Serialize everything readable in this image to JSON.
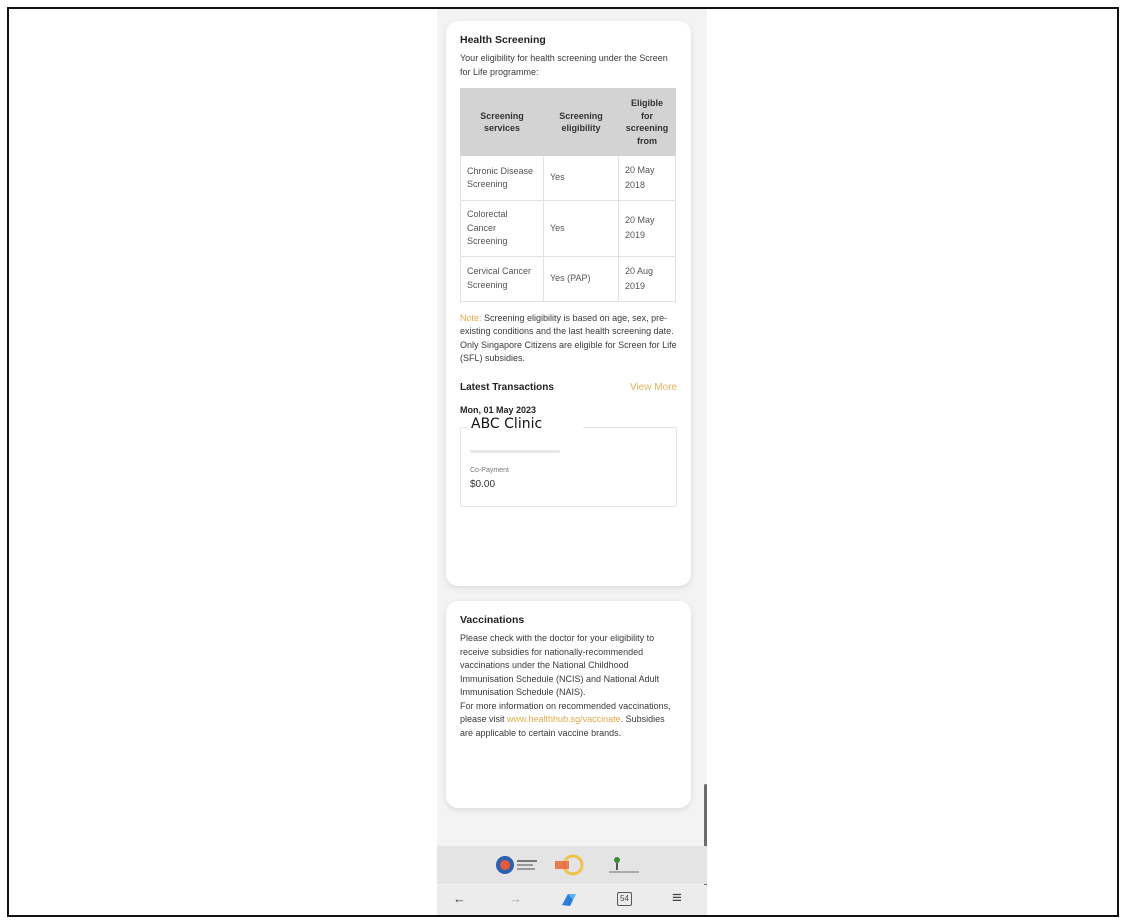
{
  "health": {
    "title": "Health Screening",
    "intro": "Your eligibility for health screening under the Screen for Life programme:",
    "table": {
      "headers": [
        "Screening services",
        "Screening eligibility",
        "Eligible for screening from"
      ],
      "rows": [
        {
          "service": "Chronic Disease Screening",
          "eligibility": "Yes",
          "from": "20 May 2018"
        },
        {
          "service": "Colorectal Cancer Screening",
          "eligibility": "Yes",
          "from": "20 May 2019"
        },
        {
          "service": "Cervical Cancer Screening",
          "eligibility": "Yes (PAP)",
          "from": "20 Aug 2019"
        }
      ]
    },
    "note_label": "Note:",
    "note_text": " Screening eligibility is based on age, sex, pre-existing conditions and the last health screening date. Only Singapore Citizens are eligible for Screen for Life (SFL) subsidies."
  },
  "transactions": {
    "title": "Latest Transactions",
    "view_more": "View More",
    "date": "Mon, 01 May 2023",
    "clinic": "ABC Clinic",
    "copay_label": "Co-Payment",
    "copay_value": "$0.00"
  },
  "vaccinations": {
    "title": "Vaccinations",
    "text1": "Please check with the doctor for your eligibility to receive subsidies for nationally-recommended vaccinations under the National Childhood Immunisation Schedule (NCIS) and National Adult Immunisation Schedule (NAIS).",
    "text2": "For more information on recommended vaccinations, please visit ",
    "link": "www.healthhub.sg/vaccinate",
    "text3": ". Subsidies are applicable to certain vaccine brands."
  },
  "navbar": {
    "back": "←",
    "forward": "→",
    "tabs_count": "54",
    "menu": "≡"
  },
  "colors": {
    "accent": "#e3a84b",
    "table_header": "#d3d3d3",
    "background": "#f3f3f3"
  },
  "icons": [
    "back-arrow-icon",
    "forward-arrow-icon",
    "browser-logo-icon",
    "tabs-icon",
    "menu-icon"
  ]
}
